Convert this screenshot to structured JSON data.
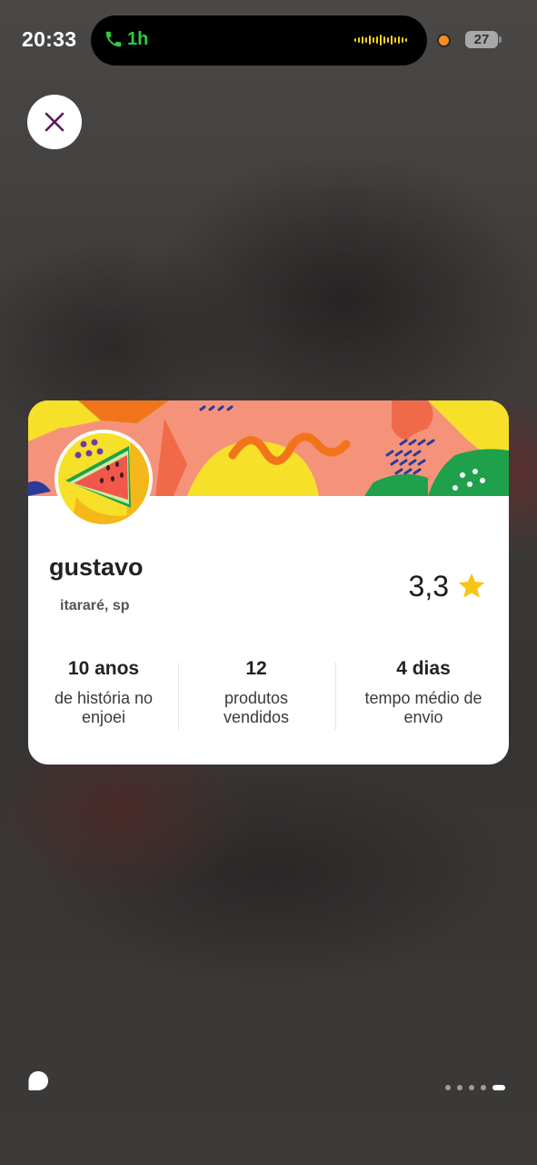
{
  "status_bar": {
    "time": "20:33",
    "call_duration": "1h",
    "battery_level": "27",
    "call_color": "#2ecc40",
    "recording_dot_color": "#ff8a1e"
  },
  "close_button": {
    "icon": "close-icon",
    "color": "#5b1a5e"
  },
  "seller": {
    "name": "gustavo",
    "location": "itararé, sp",
    "rating": "3,3",
    "rating_icon": "star-icon",
    "rating_color": "#f5c518"
  },
  "stats": [
    {
      "value": "10 anos",
      "label": "de história no enjoei"
    },
    {
      "value": "12",
      "label": "produtos vendidos"
    },
    {
      "value": "4 dias",
      "label": "tempo médio de envio"
    }
  ],
  "pager": {
    "total": 5,
    "current": 5
  }
}
